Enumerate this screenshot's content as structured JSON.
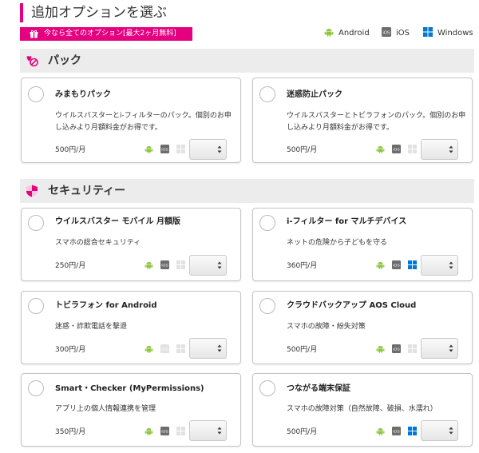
{
  "page": {
    "title": "追加オプションを選ぶ"
  },
  "promo": {
    "label": "今なら全てのオプション[最大2ヶ月無料]"
  },
  "legend": {
    "android": "Android",
    "ios": "iOS",
    "windows": "Windows"
  },
  "os_icons": {
    "android": "android-icon",
    "ios": "ios-icon",
    "windows": "windows-icon",
    "colors": {
      "android": "#8cc63f",
      "ios": "#6d6d6d",
      "windows": "#0078d7",
      "disabled": "#dddddd"
    }
  },
  "colors": {
    "accent": "#e5007f",
    "section_bg": "#ececec"
  },
  "sections": [
    {
      "title": "パック",
      "icon": "pack-icon",
      "cards": [
        {
          "name": "みまもりパック",
          "description": "ウイルスバスターとi-フィルターのパック。個別のお申し込みより月額料金がお得です。",
          "price": "500円/月",
          "android": true,
          "ios": true,
          "windows": false
        },
        {
          "name": "迷惑防止パック",
          "description": "ウイルスバスターとトビラフォンのパック。個別のお申し込みより月額料金がお得です。",
          "price": "500円/月",
          "android": true,
          "ios": true,
          "windows": false
        }
      ]
    },
    {
      "title": "セキュリティー",
      "icon": "shield-icon",
      "cards": [
        {
          "name": "ウイルスバスター モバイル 月額版",
          "description": "スマホの総合セキュリティ",
          "price": "250円/月",
          "android": true,
          "ios": true,
          "windows": false
        },
        {
          "name": "i-フィルター for マルチデバイス",
          "description": "ネットの危険から子どもを守る",
          "price": "360円/月",
          "android": true,
          "ios": true,
          "windows": true
        },
        {
          "name": "トビラフォン for Android",
          "description": "迷惑・詐欺電話を撃退",
          "price": "300円/月",
          "android": true,
          "ios": false,
          "windows": false
        },
        {
          "name": "クラウドバックアップ AOS Cloud",
          "description": "スマホの故障・紛失対策",
          "price": "500円/月",
          "android": true,
          "ios": true,
          "windows": false
        },
        {
          "name": "Smart・Checker (MyPermissions)",
          "description": "アプリ上の個人情報連携を管理",
          "price": "350円/月",
          "android": true,
          "ios": true,
          "windows": false
        },
        {
          "name": "つながる端末保証",
          "description": "スマホの故障対策（自然故障、破損、水濡れ）",
          "price": "500円/月",
          "android": true,
          "ios": true,
          "windows": true
        }
      ]
    }
  ]
}
